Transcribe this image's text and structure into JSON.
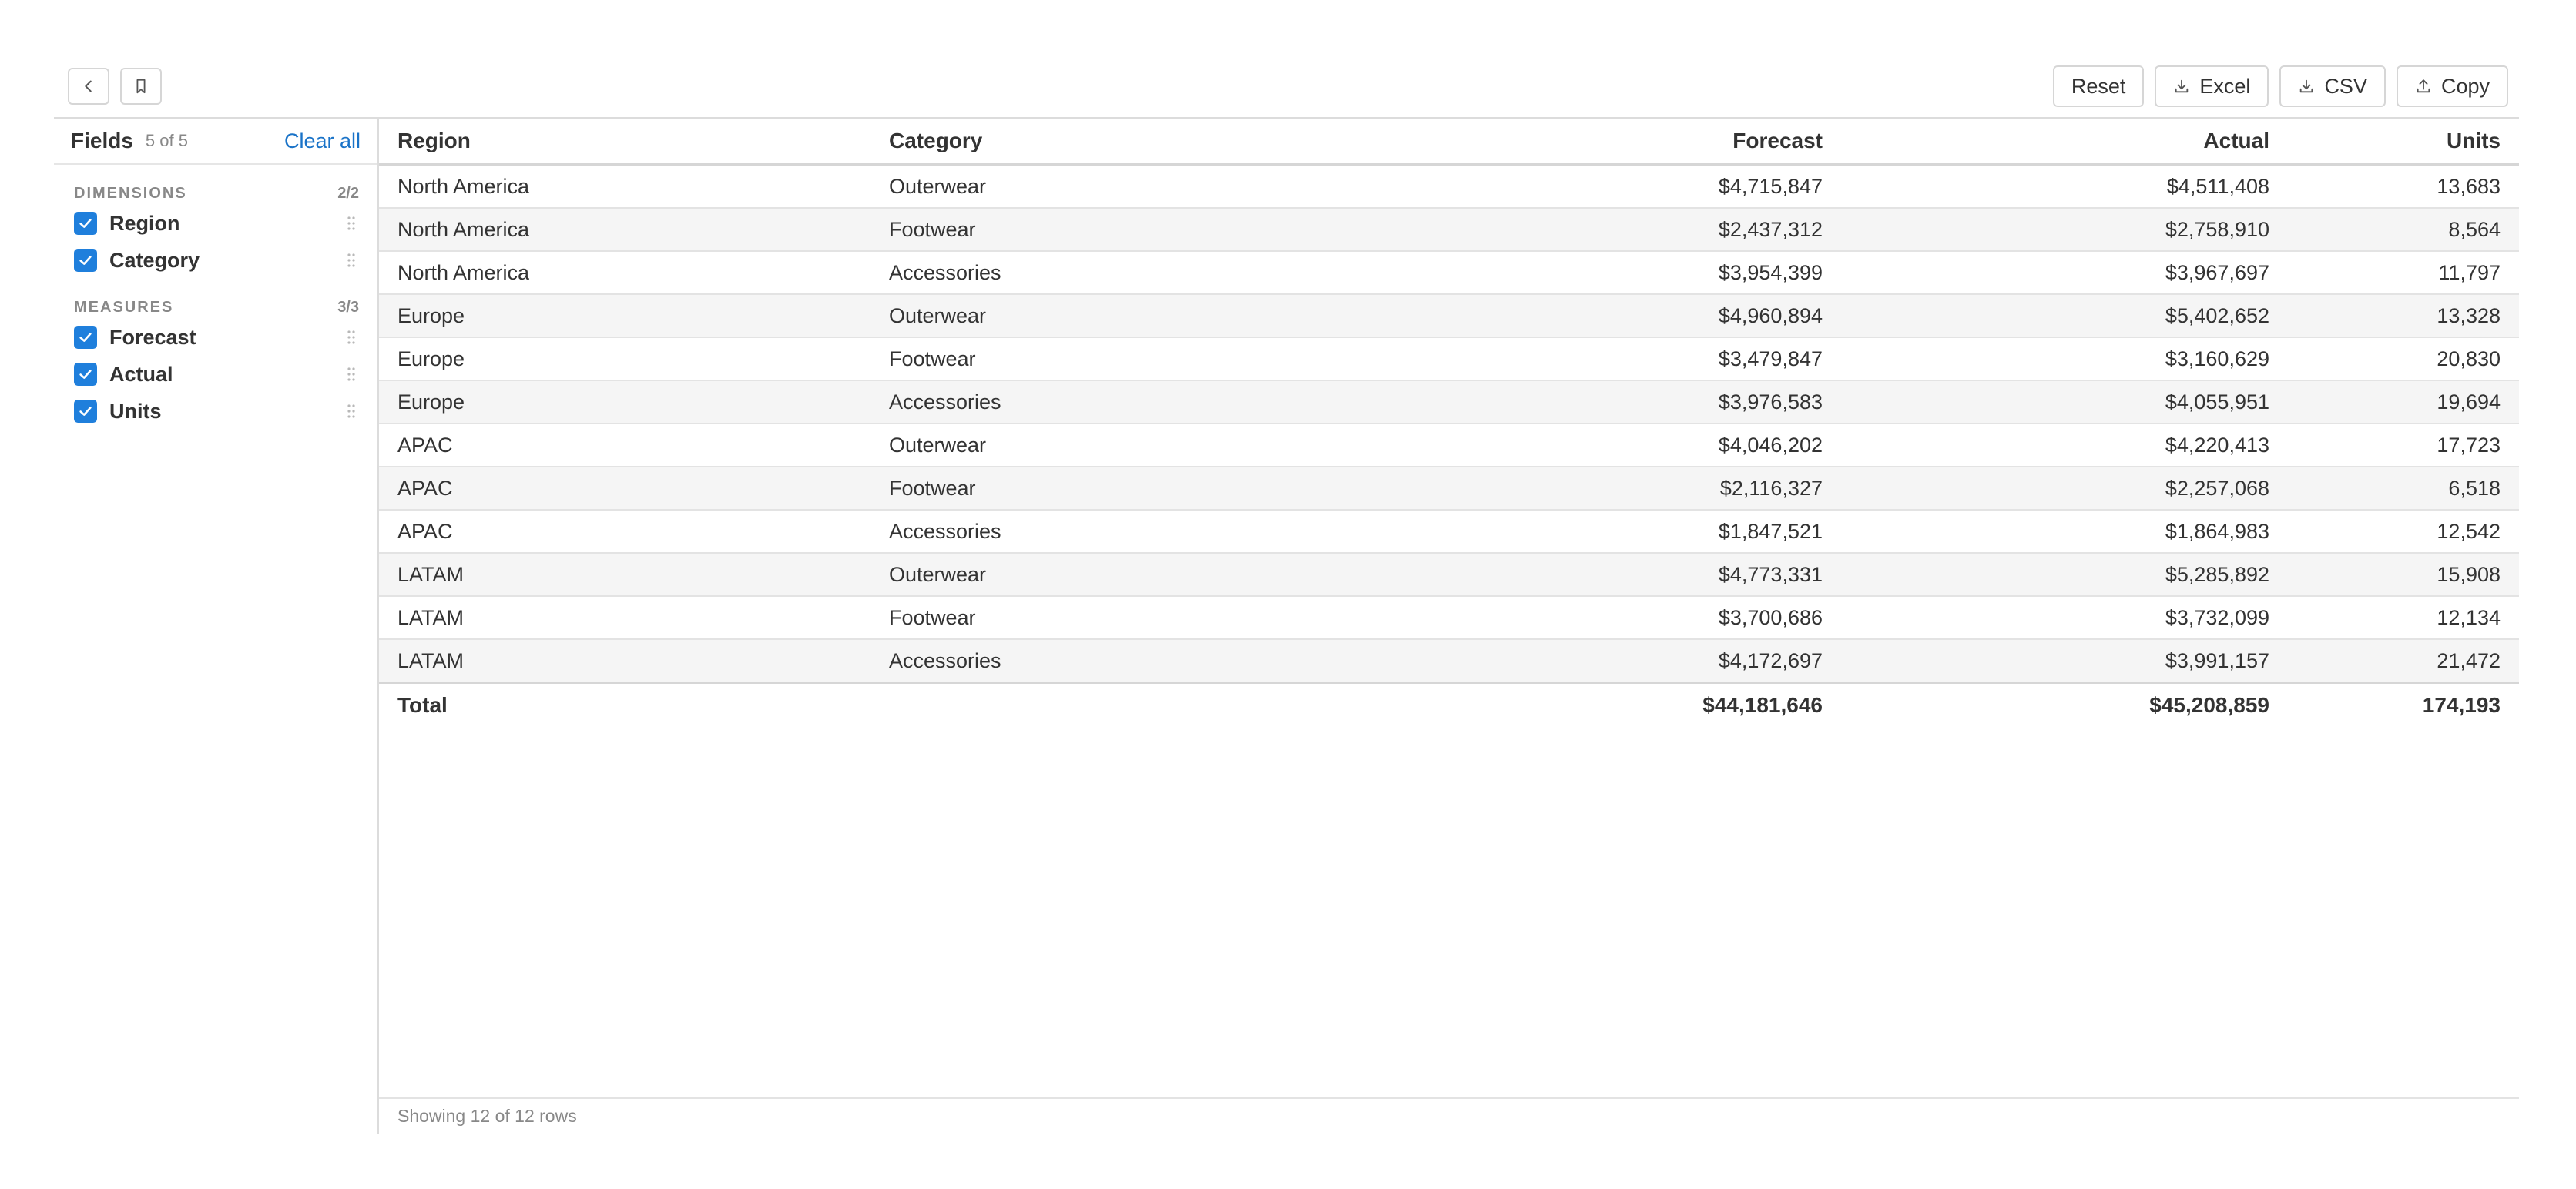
{
  "toolbar": {
    "back_icon": "chevron-left-icon",
    "bookmark_icon": "bookmark-icon",
    "actions": [
      {
        "label": "Reset",
        "icon": ""
      },
      {
        "label": "Excel",
        "icon": "download-icon"
      },
      {
        "label": "CSV",
        "icon": "download-icon"
      },
      {
        "label": "Copy",
        "icon": "upload-icon"
      }
    ]
  },
  "sidebar": {
    "title": "Fields",
    "count": "5 of 5",
    "clear_label": "Clear all",
    "dimensions": {
      "label": "DIMENSIONS",
      "count": "2/2",
      "items": [
        {
          "label": "Region",
          "checked": true
        },
        {
          "label": "Category",
          "checked": true
        }
      ]
    },
    "measures": {
      "label": "MEASURES",
      "count": "3/3",
      "items": [
        {
          "label": "Forecast",
          "checked": true
        },
        {
          "label": "Actual",
          "checked": true
        },
        {
          "label": "Units",
          "checked": true
        }
      ]
    }
  },
  "table": {
    "columns": [
      "Region",
      "Category",
      "Forecast",
      "Actual",
      "Units"
    ],
    "rows": [
      [
        "North America",
        "Outerwear",
        "$4,715,847",
        "$4,511,408",
        "13,683"
      ],
      [
        "North America",
        "Footwear",
        "$2,437,312",
        "$2,758,910",
        "8,564"
      ],
      [
        "North America",
        "Accessories",
        "$3,954,399",
        "$3,967,697",
        "11,797"
      ],
      [
        "Europe",
        "Outerwear",
        "$4,960,894",
        "$5,402,652",
        "13,328"
      ],
      [
        "Europe",
        "Footwear",
        "$3,479,847",
        "$3,160,629",
        "20,830"
      ],
      [
        "Europe",
        "Accessories",
        "$3,976,583",
        "$4,055,951",
        "19,694"
      ],
      [
        "APAC",
        "Outerwear",
        "$4,046,202",
        "$4,220,413",
        "17,723"
      ],
      [
        "APAC",
        "Footwear",
        "$2,116,327",
        "$2,257,068",
        "6,518"
      ],
      [
        "APAC",
        "Accessories",
        "$1,847,521",
        "$1,864,983",
        "12,542"
      ],
      [
        "LATAM",
        "Outerwear",
        "$4,773,331",
        "$5,285,892",
        "15,908"
      ],
      [
        "LATAM",
        "Footwear",
        "$3,700,686",
        "$3,732,099",
        "12,134"
      ],
      [
        "LATAM",
        "Accessories",
        "$4,172,697",
        "$3,991,157",
        "21,472"
      ]
    ],
    "total": [
      "Total",
      "",
      "$44,181,646",
      "$45,208,859",
      "174,193"
    ]
  },
  "status": "Showing 12 of 12 rows",
  "colors": {
    "accent": "#1f7fdc",
    "link": "#1a73c8",
    "stripe": "#f5f5f5",
    "border": "#d6d6d6"
  }
}
